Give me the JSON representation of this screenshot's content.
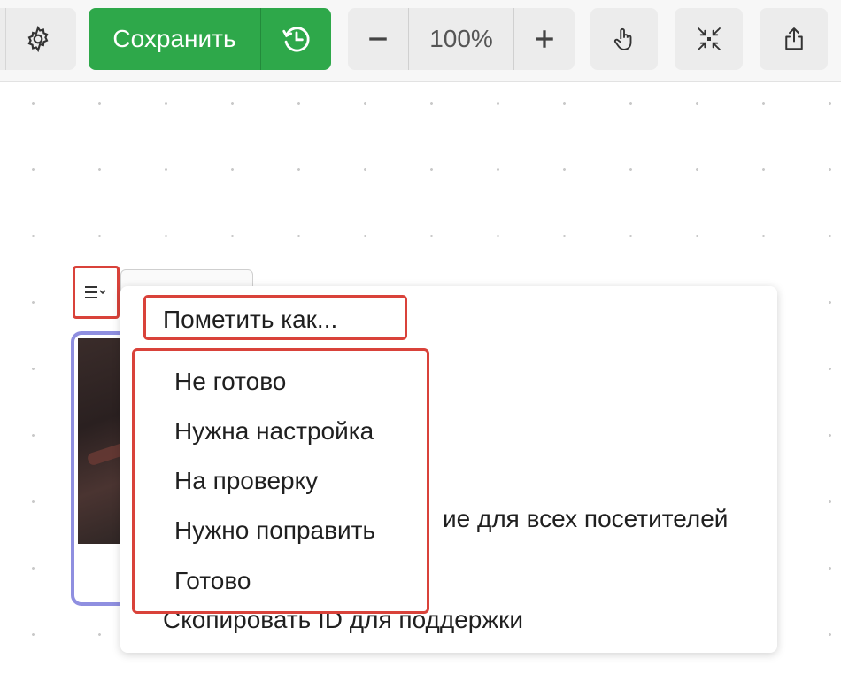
{
  "toolbar": {
    "settings_icon": "gear-icon",
    "save_label": "Сохранить",
    "history_icon": "history-clock-icon",
    "zoom_out_icon": "minus-icon",
    "zoom_level": "100%",
    "zoom_in_icon": "plus-icon",
    "hand_icon": "hand-pointer-icon",
    "fit_icon": "collapse-arrows-icon",
    "share_icon": "share-upload-icon",
    "save_color": "#2ea84a"
  },
  "node": {
    "menu_icon": "menu-lines-chevron-icon"
  },
  "context_menu": {
    "mark_as_label": "Пометить как...",
    "share_item_visible_text": "ие для всех посетителей",
    "copy_id_label": "Скопировать ID для поддержки",
    "highlight_color": "#d9423a",
    "submenu": {
      "items": [
        {
          "label": "Не готово"
        },
        {
          "label": "Нужна настройка"
        },
        {
          "label": "На проверку"
        },
        {
          "label": "Нужно поправить"
        },
        {
          "label": "Готово"
        }
      ]
    }
  }
}
